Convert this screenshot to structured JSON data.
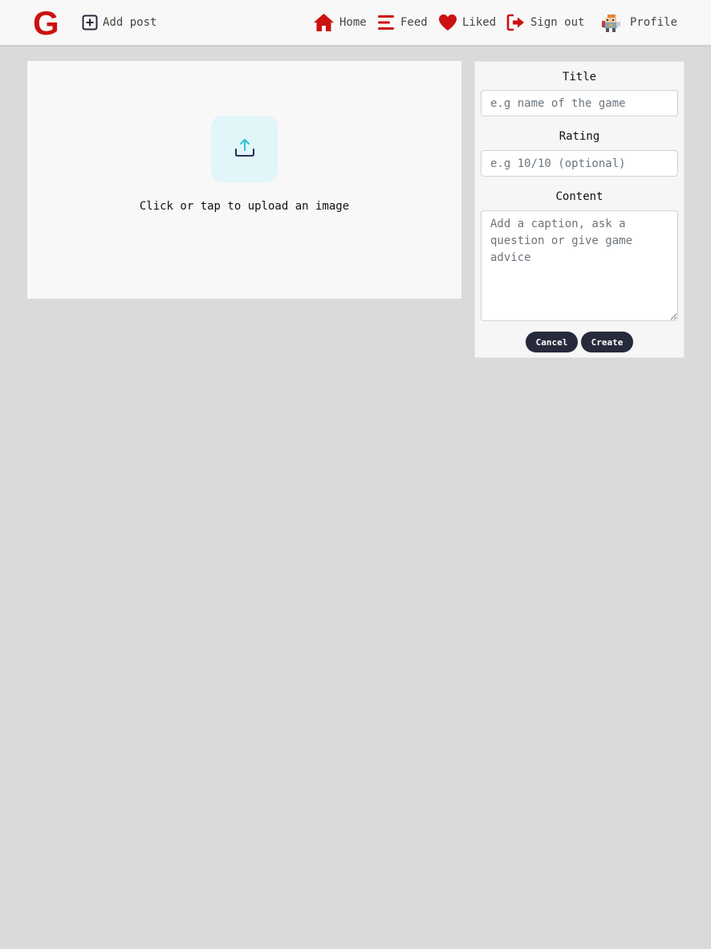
{
  "navbar": {
    "logo_text": "G",
    "add_post_label": "Add post",
    "home_label": "Home",
    "feed_label": "Feed",
    "liked_label": "Liked",
    "sign_out_label": "Sign out",
    "profile_label": "Profile",
    "icons": {
      "add_post": "plus-square-icon",
      "home": "home-icon",
      "feed": "bars-icon",
      "liked": "heart-icon",
      "sign_out": "sign-out-icon",
      "profile": "avatar"
    }
  },
  "upload": {
    "icon": "upload-icon",
    "text": "Click or tap to upload an image"
  },
  "form": {
    "title_label": "Title",
    "title_placeholder": "e.g name of the game",
    "rating_label": "Rating",
    "rating_placeholder": "e.g 10/10 (optional)",
    "content_label": "Content",
    "content_placeholder": "Add a caption, ask a question or give game advice",
    "cancel_label": "Cancel",
    "create_label": "Create"
  },
  "colors": {
    "brand_red": "#cc1111",
    "background": "#dadada",
    "panel": "#f8f8f8",
    "button": "#262a3b",
    "upload_box": "#e2f5f9",
    "upload_arrow": "#2ec4d6"
  }
}
